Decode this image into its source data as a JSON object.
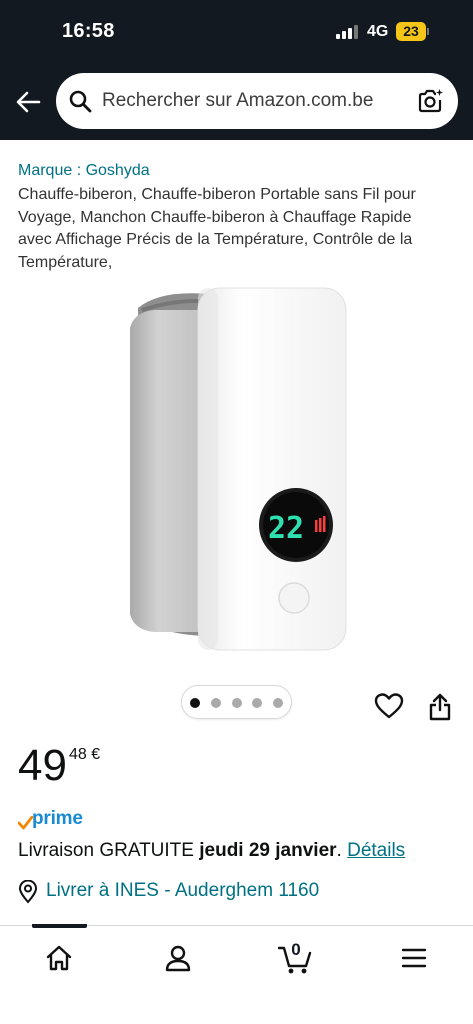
{
  "status_bar": {
    "time": "16:58",
    "network": "4G",
    "battery": "23"
  },
  "search": {
    "placeholder": "Rechercher sur Amazon.com.be"
  },
  "product": {
    "brand": "Marque : Goshyda",
    "title": "Chauffe-biberon, Chauffe-biberon Portable sans Fil pour Voyage, Manchon Chauffe-biberon à Chauffage Rapide avec Affichage Précis de la Température, Contrôle de la Température,",
    "display_reading": "22",
    "image_count": 5,
    "active_image": 1
  },
  "price": {
    "whole": "49",
    "fraction": "48 €"
  },
  "prime": {
    "label": "prime"
  },
  "delivery": {
    "prefix": "Livraison GRATUITE ",
    "date": "jeudi 29 janvier",
    "suffix": ". ",
    "details_link": "Détails"
  },
  "location": {
    "text": "Livrer à INES - Auderghem 1160"
  },
  "bottom_nav": {
    "cart_count": "0",
    "active_tab": "home"
  },
  "colors": {
    "header_bg": "#131921",
    "link": "#007185",
    "prime_blue": "#1a8ad3",
    "prime_check": "#f08804",
    "battery": "#f5c518"
  }
}
